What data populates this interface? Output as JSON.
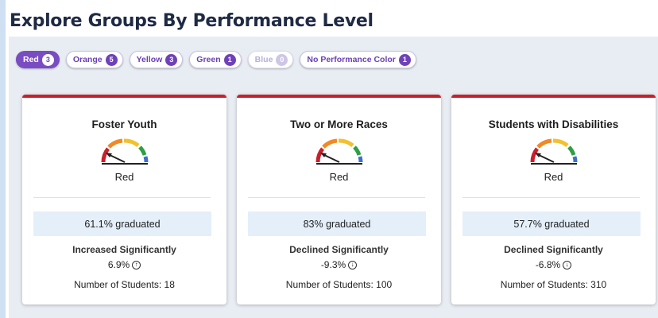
{
  "section": {
    "title": "Explore Groups By Performance Level"
  },
  "filters": [
    {
      "label": "Red",
      "count": "3",
      "state": "active"
    },
    {
      "label": "Orange",
      "count": "5",
      "state": "normal"
    },
    {
      "label": "Yellow",
      "count": "3",
      "state": "normal"
    },
    {
      "label": "Green",
      "count": "1",
      "state": "normal"
    },
    {
      "label": "Blue",
      "count": "0",
      "state": "disabled"
    },
    {
      "label": "No Performance Color",
      "count": "1",
      "state": "normal"
    }
  ],
  "colors": {
    "red": "#c8202b",
    "orange": "#f08a24",
    "yellow": "#f2c12e",
    "green": "#2f9e44",
    "blue": "#3b6fd1",
    "accent": "#7a4cc2"
  },
  "cards": [
    {
      "name": "Foster Youth",
      "level": "Red",
      "metric": "61.1% graduated",
      "change_label": "Increased Significantly",
      "change_value": "6.9%",
      "change_icon": "arrow-up-circle-icon",
      "students": "Number of Students: 18"
    },
    {
      "name": "Two or More Races",
      "level": "Red",
      "metric": "83% graduated",
      "change_label": "Declined Significantly",
      "change_value": "-9.3%",
      "change_icon": "arrow-down-circle-icon",
      "students": "Number of Students: 100"
    },
    {
      "name": "Students with Disabilities",
      "level": "Red",
      "metric": "57.7% graduated",
      "change_label": "Declined Significantly",
      "change_value": "-6.8%",
      "change_icon": "arrow-down-circle-icon",
      "students": "Number of Students: 310"
    }
  ]
}
